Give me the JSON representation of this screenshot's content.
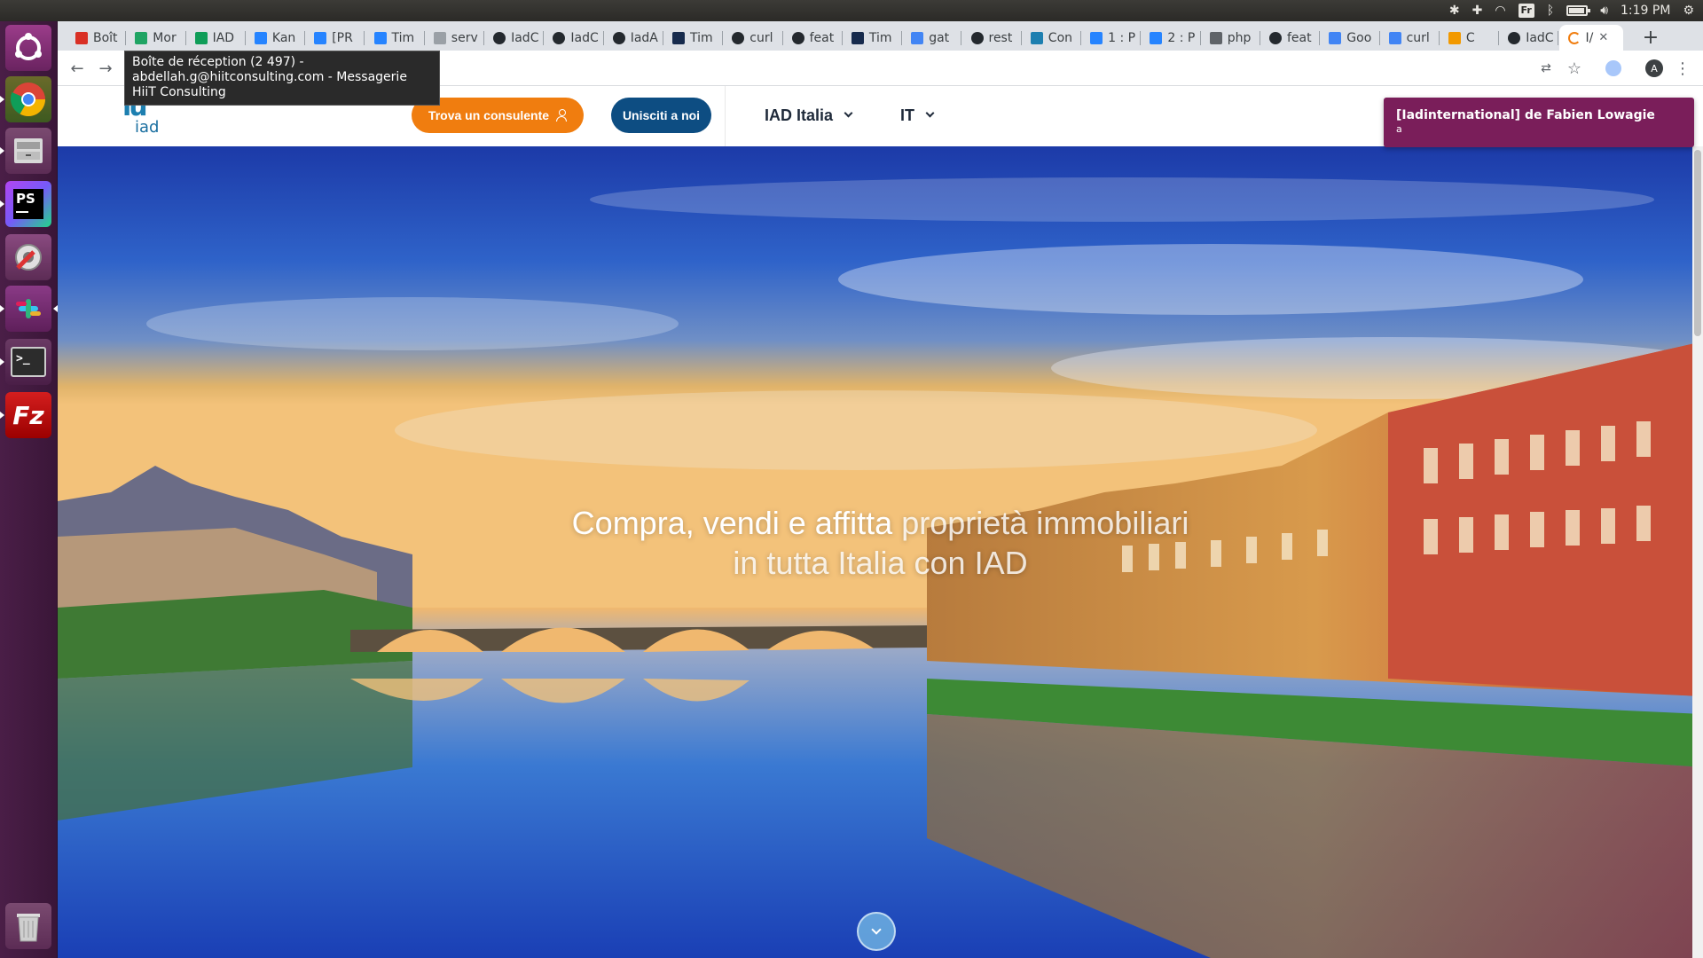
{
  "system_panel": {
    "keyboard_layout": "Fr",
    "clock": "1:19 PM"
  },
  "launcher": {
    "items": [
      {
        "name": "ubuntu-dash",
        "color": "#e95420"
      },
      {
        "name": "chrome",
        "color": "#4285f4"
      },
      {
        "name": "files",
        "color": "#8a8a8a"
      },
      {
        "name": "phpstorm",
        "label": "PS",
        "color": "#21d789"
      },
      {
        "name": "system-settings",
        "color": "#7a7a7a"
      },
      {
        "name": "slack",
        "color": "#4a154b"
      },
      {
        "name": "terminal",
        "label": ">_",
        "color": "#2c2c2c"
      },
      {
        "name": "filezilla",
        "label": "Fz",
        "color": "#bf0000"
      },
      {
        "name": "trash",
        "color": "#9a9a9a"
      }
    ]
  },
  "browser": {
    "tabs": [
      {
        "label": "Boît",
        "icon": "gmail-icon",
        "color": "#d93025"
      },
      {
        "label": "Mor",
        "icon": "google-drive-icon",
        "color": "#1fa463"
      },
      {
        "label": "IAD",
        "icon": "google-sheets-icon",
        "color": "#0f9d58"
      },
      {
        "label": "Kan",
        "icon": "jira-icon",
        "color": "#2684ff"
      },
      {
        "label": "[PR",
        "icon": "jira-icon",
        "color": "#2684ff"
      },
      {
        "label": "Tim",
        "icon": "jira-icon",
        "color": "#2684ff"
      },
      {
        "label": "serv",
        "icon": "page-icon",
        "color": "#9aa0a6"
      },
      {
        "label": "IadC",
        "icon": "github-icon",
        "color": "#24292e"
      },
      {
        "label": "IadC",
        "icon": "github-icon",
        "color": "#24292e"
      },
      {
        "label": "IadA",
        "icon": "github-icon",
        "color": "#24292e"
      },
      {
        "label": "Tim",
        "icon": "confluence-icon",
        "color": "#172b4d"
      },
      {
        "label": "curl",
        "icon": "github-icon",
        "color": "#24292e"
      },
      {
        "label": "feat",
        "icon": "github-icon",
        "color": "#24292e"
      },
      {
        "label": "Tim",
        "icon": "confluence-icon",
        "color": "#172b4d"
      },
      {
        "label": "gat",
        "icon": "google-icon",
        "color": "#4285f4"
      },
      {
        "label": "rest",
        "icon": "github-icon",
        "color": "#24292e"
      },
      {
        "label": "Con",
        "icon": "iad-icon",
        "color": "#1d7fb0"
      },
      {
        "label": "1 : P",
        "icon": "pivotal-icon",
        "color": "#2684ff"
      },
      {
        "label": "2 : P",
        "icon": "pivotal-icon",
        "color": "#2684ff"
      },
      {
        "label": "php",
        "icon": "stackoverflow-icon",
        "color": "#5f6368"
      },
      {
        "label": "feat",
        "icon": "github-icon",
        "color": "#24292e"
      },
      {
        "label": "Goo",
        "icon": "google-translate-icon",
        "color": "#4285f4"
      },
      {
        "label": "curl",
        "icon": "google-icon",
        "color": "#4285f4"
      },
      {
        "label": "C",
        "icon": "recording-icon",
        "color": "#f29900"
      },
      {
        "label": "IadC",
        "icon": "github-icon",
        "color": "#24292e"
      },
      {
        "label": "I/",
        "icon": "loading-icon",
        "color": "#f07d0f",
        "active": true
      }
    ],
    "tooltip": "Boîte de réception (2 497) - abdellah.g@hiitconsulting.com - Messagerie HiiT Consulting",
    "profile_initial": "A"
  },
  "site": {
    "logo_text": "iad",
    "cta_consultant": "Trova un consulente",
    "cta_join": "Unisciti a noi",
    "country_menu": "IAD Italia",
    "language_menu": "IT",
    "hero": {
      "line1_strong": "Compra, vendi e affitta",
      "line1_light": "proprietà immobiliari",
      "line2_light": "in tutta Italia con IAD"
    }
  },
  "notification": {
    "title": "[Iadinternational] de Fabien Lowagie",
    "body": "a"
  }
}
